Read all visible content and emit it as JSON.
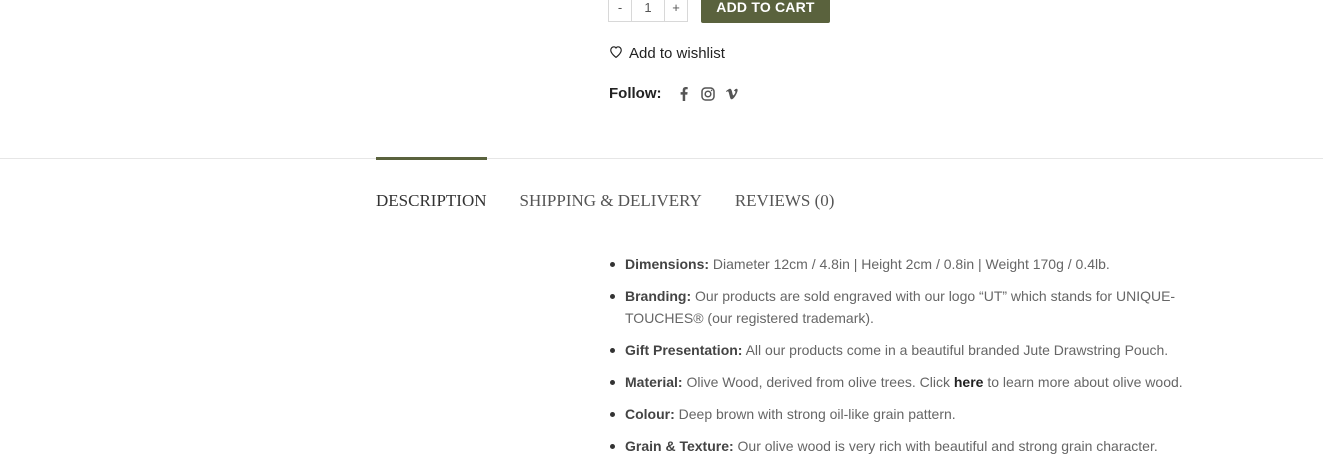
{
  "cart": {
    "qty_minus": "-",
    "qty_value": "1",
    "qty_plus": "+",
    "add_to_cart_label": "ADD TO CART"
  },
  "wishlist": {
    "label": "Add to wishlist"
  },
  "follow": {
    "label": "Follow:",
    "icons": [
      "facebook-icon",
      "instagram-icon",
      "vimeo-icon"
    ]
  },
  "tabs": [
    {
      "label": "DESCRIPTION"
    },
    {
      "label": "SHIPPING & DELIVERY"
    },
    {
      "label": "REVIEWS (0)"
    }
  ],
  "description": {
    "items": [
      {
        "label": "Dimensions:",
        "text": " Diameter 12cm / 4.8in | Height 2cm / 0.8in | Weight 170g / 0.4lb."
      },
      {
        "label": "Branding:",
        "text": " Our products are sold engraved with our logo “UT” which stands for UNIQUE-TOUCHES® (our registered trademark)."
      },
      {
        "label": "Gift Presentation:",
        "text": " All our products come in a beautiful branded Jute Drawstring Pouch."
      },
      {
        "label": "Material:",
        "text_before": " Olive Wood, derived from olive trees. Click ",
        "link": "here",
        "text_after": " to learn more about olive wood."
      },
      {
        "label": "Colour:",
        "text": " Deep brown with strong oil-like grain pattern."
      },
      {
        "label": "Grain & Texture:",
        "text": " Our olive wood is very rich with beautiful and strong grain character."
      }
    ]
  },
  "colors": {
    "accent": "#5a623d",
    "text": "#666666",
    "divider": "#e6e6e6"
  }
}
